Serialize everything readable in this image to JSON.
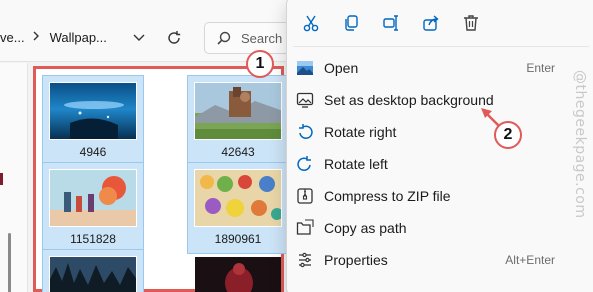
{
  "explorer": {
    "breadcrumb": [
      "ve...",
      "Wallpap..."
    ],
    "search_placeholder": "Search"
  },
  "files": [
    {
      "name": "4946",
      "selected": true
    },
    {
      "name": "42643",
      "selected": true
    },
    {
      "name": "1151828",
      "selected": true
    },
    {
      "name": "1890961",
      "selected": true
    },
    {
      "name": "",
      "selected": true
    },
    {
      "name": "",
      "selected": false
    }
  ],
  "context_menu": {
    "quick_actions": [
      "cut-icon",
      "copy-icon",
      "rename-icon",
      "share-icon",
      "delete-icon"
    ],
    "items": [
      {
        "label": "Open",
        "shortcut": "Enter",
        "icon": "open-icon"
      },
      {
        "label": "Set as desktop background",
        "shortcut": "",
        "icon": "set-background-icon"
      },
      {
        "label": "Rotate right",
        "shortcut": "",
        "icon": "rotate-right-icon"
      },
      {
        "label": "Rotate left",
        "shortcut": "",
        "icon": "rotate-left-icon"
      },
      {
        "label": "Compress to ZIP file",
        "shortcut": "",
        "icon": "zip-icon"
      },
      {
        "label": "Copy as path",
        "shortcut": "",
        "icon": "copy-path-icon"
      },
      {
        "label": "Properties",
        "shortcut": "Alt+Enter",
        "icon": "properties-icon"
      }
    ]
  },
  "annotations": {
    "badge_1": "1",
    "badge_2": "2",
    "color": "#e05a57"
  },
  "watermark": "@thegeekpage.com",
  "colors": {
    "selection": "#cce4f7",
    "accent": "#0067c0",
    "annotation": "#e05a57"
  }
}
